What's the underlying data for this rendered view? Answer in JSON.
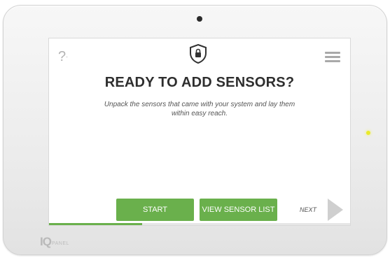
{
  "screen": {
    "help_label": "?",
    "title": "READY TO ADD SENSORS?",
    "description": "Unpack the sensors that came with your system and lay them within easy reach.",
    "buttons": {
      "start": "START",
      "view_sensor_list": "VIEW SENSOR LIST",
      "next": "NEXT"
    },
    "progress": 0.31,
    "accent_color": "#6ab04c"
  },
  "device": {
    "brand_mark": "IQ",
    "brand_text": "PANEL"
  }
}
